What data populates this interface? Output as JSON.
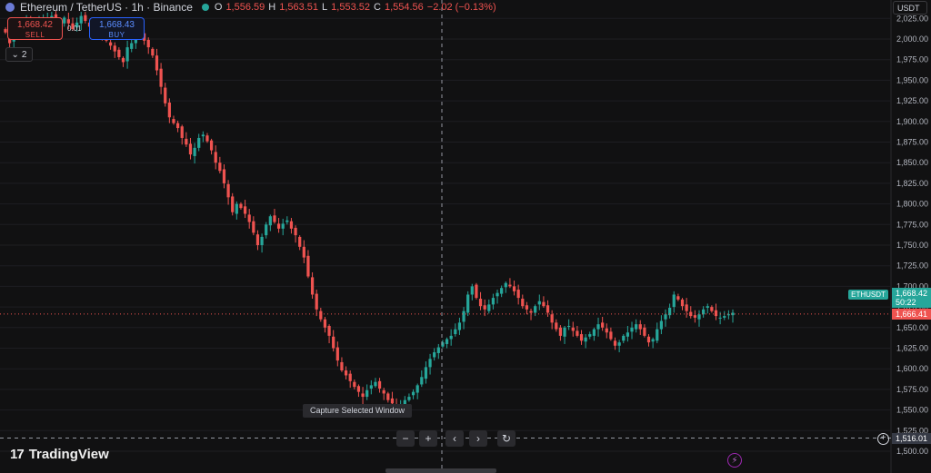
{
  "header": {
    "symbol_title": "Ethereum / TetherUS · 1h · Binance",
    "o_label": "O",
    "o_value": "1,556.59",
    "h_label": "H",
    "h_value": "1,563.51",
    "l_label": "L",
    "l_value": "1,553.52",
    "c_label": "C",
    "c_value": "1,554.56",
    "change": "−2.02 (−0.13%)"
  },
  "trade": {
    "sell_price": "1,668.42",
    "sell_label": "SELL",
    "spread": "0.01",
    "buy_price": "1,668.43",
    "buy_label": "BUY"
  },
  "indicators_toggle": "2",
  "axis": {
    "currency": "USDT",
    "symbol_badge": "ETHUSDT",
    "current_price": "1,668.42",
    "countdown": "50:22",
    "last_price": "1,666.41",
    "crosshair_price": "1,516.01"
  },
  "controls": {
    "tooltip": "Capture Selected Window",
    "zoom_out": "−",
    "zoom_in": "+",
    "scroll_left": "‹",
    "scroll_right": "›",
    "reset": "↻"
  },
  "brand": {
    "name": "TradingView",
    "mark": "17"
  },
  "colors": {
    "up": "#26a69a",
    "down": "#ef5350",
    "background": "#111112",
    "grid": "#1e1e22"
  },
  "chart_data": {
    "type": "candlestick",
    "interval": "1h",
    "ylim": [
      1500,
      2030
    ],
    "yticks": [
      "1,500.00",
      "1,525.00",
      "1,550.00",
      "1,575.00",
      "1,600.00",
      "1,625.00",
      "1,650.00",
      "1,675.00",
      "1,700.00",
      "1,725.00",
      "1,750.00",
      "1,775.00",
      "1,800.00",
      "1,825.00",
      "1,850.00",
      "1,875.00",
      "1,900.00",
      "1,925.00",
      "1,950.00",
      "1,975.00",
      "2,000.00",
      "2,025.00"
    ],
    "close_path": [
      2008,
      1995,
      2005,
      2012,
      2010,
      2025,
      2022,
      2015,
      2020,
      2023,
      2026,
      2028,
      2024,
      2018,
      2026,
      2019,
      2012,
      2020,
      2028,
      2022,
      2015,
      2008,
      2012,
      2005,
      1998,
      1992,
      1985,
      1978,
      1972,
      1990,
      1995,
      2003,
      2008,
      1998,
      1990,
      1980,
      1962,
      1942,
      1922,
      1905,
      1898,
      1892,
      1880,
      1872,
      1860,
      1868,
      1880,
      1884,
      1876,
      1865,
      1850,
      1840,
      1825,
      1808,
      1790,
      1800,
      1795,
      1788,
      1778,
      1765,
      1750,
      1760,
      1775,
      1785,
      1778,
      1770,
      1776,
      1780,
      1770,
      1762,
      1748,
      1735,
      1712,
      1690,
      1672,
      1660,
      1650,
      1640,
      1625,
      1610,
      1598,
      1592,
      1585,
      1578,
      1572,
      1566,
      1574,
      1580,
      1584,
      1576,
      1570,
      1562,
      1558,
      1554,
      1556,
      1562,
      1566,
      1572,
      1580,
      1590,
      1602,
      1612,
      1620,
      1626,
      1632,
      1636,
      1640,
      1648,
      1656,
      1670,
      1690,
      1700,
      1686,
      1676,
      1672,
      1678,
      1686,
      1692,
      1698,
      1704,
      1700,
      1694,
      1686,
      1676,
      1672,
      1668,
      1676,
      1682,
      1676,
      1668,
      1656,
      1648,
      1640,
      1650,
      1652,
      1646,
      1640,
      1634,
      1638,
      1642,
      1648,
      1654,
      1650,
      1644,
      1636,
      1628,
      1632,
      1640,
      1644,
      1650,
      1654,
      1648,
      1640,
      1632,
      1636,
      1648,
      1658,
      1666,
      1674,
      1690,
      1684,
      1676,
      1670,
      1664,
      1662,
      1666,
      1672,
      1676,
      1670,
      1664,
      1662,
      1664,
      1666,
      1668
    ]
  }
}
